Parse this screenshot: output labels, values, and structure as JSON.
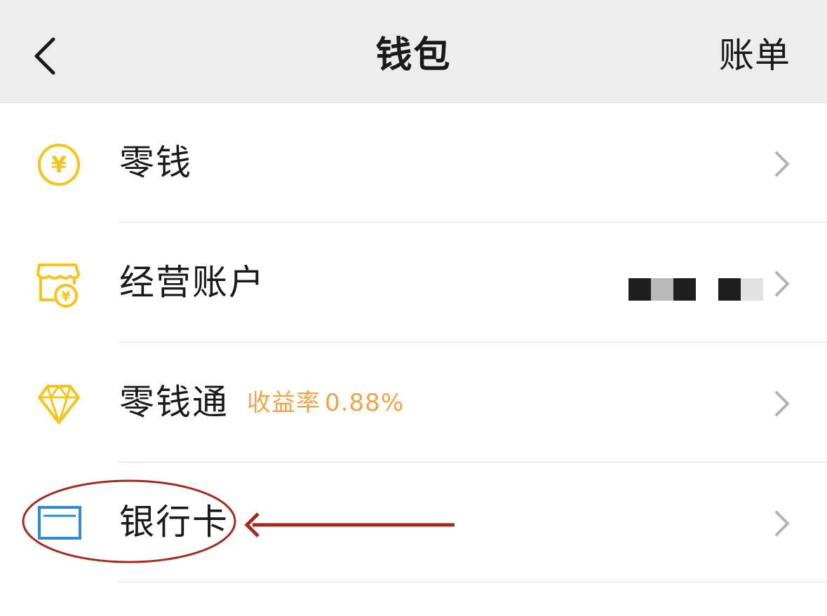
{
  "header": {
    "title": "钱包",
    "bill_label": "账单"
  },
  "rows": [
    {
      "label": "零钱",
      "icon": "yuan-coin-icon"
    },
    {
      "label": "经营账户",
      "icon": "store-yuan-icon"
    },
    {
      "label": "零钱通",
      "icon": "diamond-icon",
      "yield_label": "收益率",
      "yield_value": "0.88%"
    },
    {
      "label": "银行卡",
      "icon": "bank-card-icon"
    }
  ],
  "colors": {
    "header_bg": "#ededed",
    "icon_yellow": "#f5c518",
    "yield_orange": "#f0a447",
    "card_blue": "#2f8bd8",
    "annotation_red": "#a52a1e"
  }
}
